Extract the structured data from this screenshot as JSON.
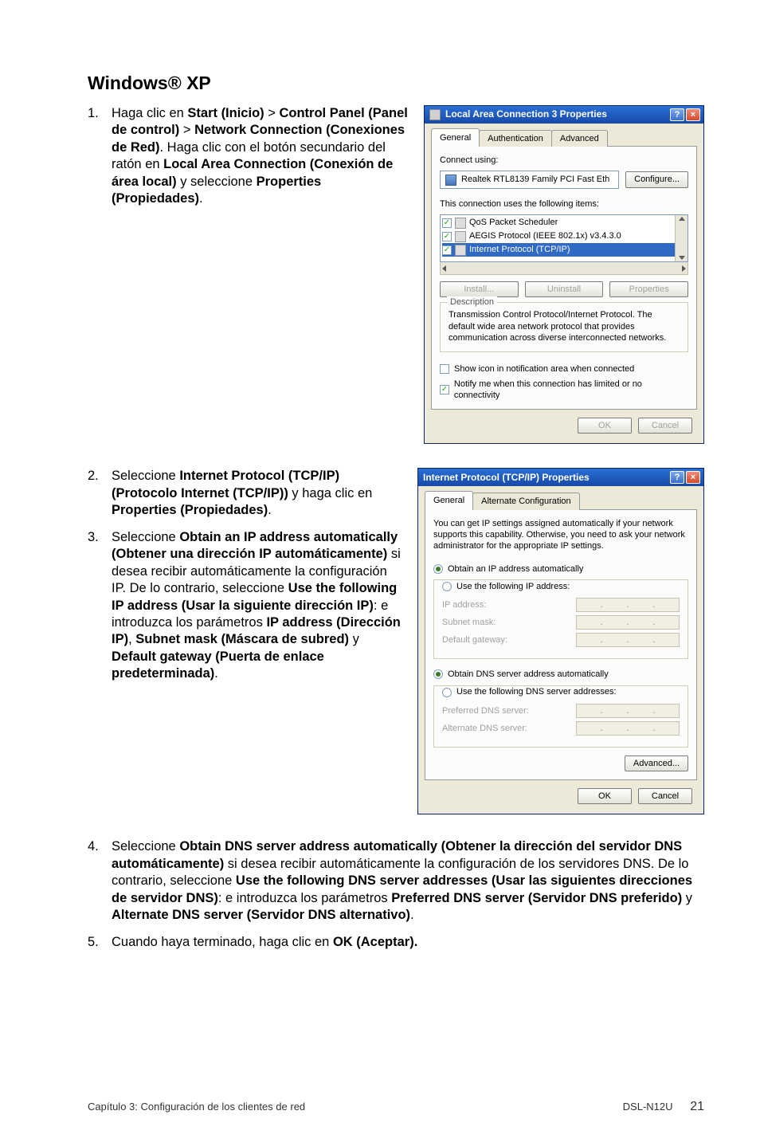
{
  "heading": "Windows® XP",
  "steps": {
    "s1_num": "1.",
    "s1_a": "Haga clic en ",
    "s1_b": "Start (Inicio)",
    "s1_c": " > ",
    "s1_d": "Control Panel (Panel de control)",
    "s1_e": " > ",
    "s1_f": "Network Connection (Conexiones de Red)",
    "s1_g": ". Haga clic con el botón secundario del ratón en ",
    "s1_h": "Local Area Connection (Conexión de área local)",
    "s1_i": " y seleccione ",
    "s1_j": "Properties (Propiedades)",
    "s1_k": ".",
    "s2_num": "2.",
    "s2_a": "Seleccione ",
    "s2_b": "Internet Protocol (TCP/IP) (Protocolo Internet (TCP/IP))",
    "s2_c": " y haga clic en ",
    "s2_d": "Properties (Propiedades)",
    "s2_e": ".",
    "s3_num": "3.",
    "s3_a": "Seleccione ",
    "s3_b": "Obtain an IP address automatically (Obtener una dirección IP automáticamente)",
    "s3_c": " si desea recibir automáticamente la configuración IP. De lo contrario, seleccione ",
    "s3_d": "Use the following IP address (Usar la siguiente dirección IP)",
    "s3_e": ": e introduzca los parámetros ",
    "s3_f": "IP address (Dirección IP)",
    "s3_g": ", ",
    "s3_h": "Subnet mask (Máscara de subred)",
    "s3_i": " y ",
    "s3_j": "Default gateway (Puerta de enlace predeterminada)",
    "s3_k": ".",
    "s4_num": "4.",
    "s4_a": "Seleccione ",
    "s4_b": "Obtain DNS server address automatically (Obtener la dirección del servidor DNS automáticamente)",
    "s4_c": " si desea recibir automáticamente la configuración de los servidores DNS. De lo contrario, seleccione ",
    "s4_d": "Use the following DNS server addresses (Usar las siguientes direcciones de servidor DNS)",
    "s4_e": ": e introduzca los parámetros ",
    "s4_f": "Preferred DNS server (Servidor DNS preferido)",
    "s4_g": " y ",
    "s4_h": "Alternate DNS server (Servidor DNS alternativo)",
    "s4_i": ".",
    "s5_num": "5.",
    "s5_a": "Cuando haya terminado, haga clic en ",
    "s5_b": "OK (Aceptar).",
    "s5_c": ""
  },
  "dlg1": {
    "title": "Local Area Connection 3 Properties",
    "help": "?",
    "close": "×",
    "tabs": {
      "general": "General",
      "auth": "Authentication",
      "adv": "Advanced"
    },
    "connect_using_label": "Connect using:",
    "adapter": "Realtek RTL8139 Family PCI Fast Eth",
    "configure_btn": "Configure...",
    "items_label": "This connection uses the following items:",
    "item_qos": "QoS Packet Scheduler",
    "item_aegis": "AEGIS Protocol (IEEE 802.1x) v3.4.3.0",
    "item_tcpip": "Internet Protocol (TCP/IP)",
    "install_btn": "Install...",
    "uninstall_btn": "Uninstall",
    "properties_btn": "Properties",
    "desc_legend": "Description",
    "desc_text": "Transmission Control Protocol/Internet Protocol. The default wide area network protocol that provides communication across diverse interconnected networks.",
    "chk_show_icon": "Show icon in notification area when connected",
    "chk_notify": "Notify me when this connection has limited or no connectivity",
    "ok": "OK",
    "cancel": "Cancel"
  },
  "dlg2": {
    "title": "Internet Protocol (TCP/IP) Properties",
    "help": "?",
    "close": "×",
    "tabs": {
      "general": "General",
      "alt": "Alternate Configuration"
    },
    "intro": "You can get IP settings assigned automatically if your network supports this capability. Otherwise, you need to ask your network administrator for the appropriate IP settings.",
    "radio_auto_ip": "Obtain an IP address automatically",
    "radio_use_ip": "Use the following IP address:",
    "ip_label": "IP address:",
    "mask_label": "Subnet mask:",
    "gw_label": "Default gateway:",
    "radio_auto_dns": "Obtain DNS server address automatically",
    "radio_use_dns": "Use the following DNS server addresses:",
    "pref_dns": "Preferred DNS server:",
    "alt_dns": "Alternate DNS server:",
    "advanced_btn": "Advanced...",
    "ok": "OK",
    "cancel": "Cancel"
  },
  "footer": {
    "left": "Capítulo 3: Configuración de los clientes de red",
    "model": "DSL-N12U",
    "page": "21"
  }
}
